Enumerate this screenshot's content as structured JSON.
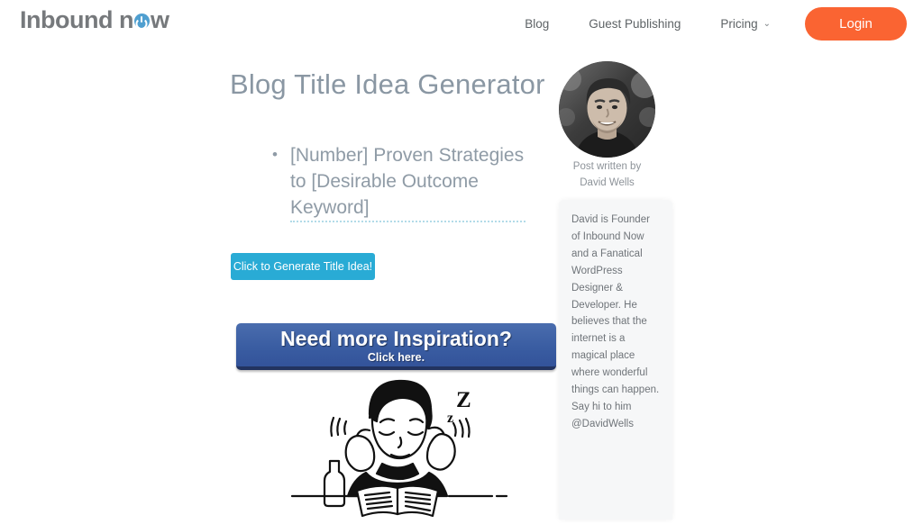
{
  "header": {
    "logo": {
      "text_before": "Inb",
      "text_mid": "ound n",
      "icon": "power-icon",
      "text_after": "w",
      "full_text": "Inbound now"
    },
    "nav": [
      {
        "label": "Blog",
        "has_caret": false
      },
      {
        "label": "Guest Publishing",
        "has_caret": false
      },
      {
        "label": "Pricing",
        "has_caret": true,
        "caret": "⌄"
      }
    ],
    "login_label": "Login"
  },
  "main": {
    "page_title": "Blog Title Idea Generator",
    "idea": "[Number] Proven Strategies to [Desirable Outcome Keyword]",
    "generate_label": "Click to Generate Title Idea!",
    "banner": {
      "title": "Need more Inspiration?",
      "subtitle": "Click here."
    },
    "illustration_alt": "sleeping-person-covering-ears-with-book-illustration"
  },
  "author": {
    "avatar_alt": "david-wells-portrait",
    "written_by_label": "Post written by",
    "name": "David Wells",
    "bio": "David is Founder of Inbound Now and a Fanatical WordPress Designer & Developer. He believes that the internet is a magical place where wonderful things can happen. Say hi to him @DavidWells"
  },
  "colors": {
    "accent_orange": "#fa6432",
    "accent_blue": "#29abd5",
    "banner_blue": "#3a5da2",
    "title_gray": "#8a97a3",
    "body_gray": "#6f7479",
    "card_bg": "#f6f7f8",
    "logo_gray": "#76797c",
    "power_icon_blue": "#4f9fd0",
    "dotted_rule": "#b2dbe8"
  }
}
